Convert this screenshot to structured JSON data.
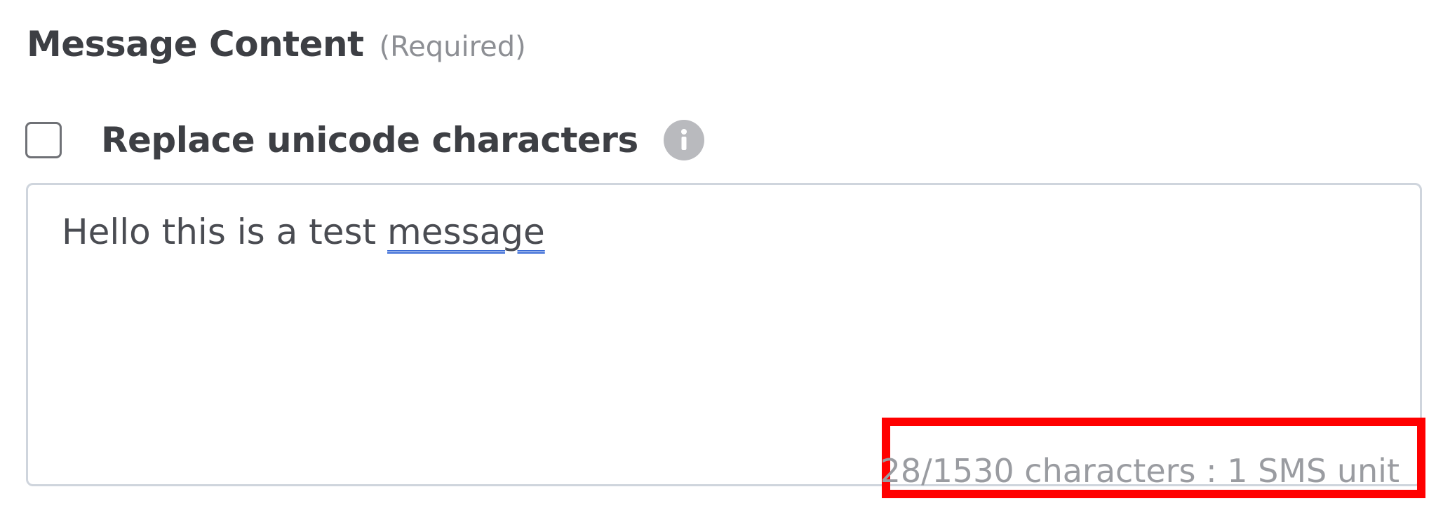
{
  "section": {
    "title": "Message Content",
    "required_label": "(Required)"
  },
  "options": {
    "replace_unicode": {
      "label": "Replace unicode characters",
      "checked": false,
      "info_icon": "info-icon"
    }
  },
  "message": {
    "text_before": "Hello this is a test ",
    "misspelled_word": "message"
  },
  "counter": {
    "text": "28/1530 characters : 1 SMS unit"
  },
  "colors": {
    "highlight": "#ff0000",
    "spellcheck_underline": "#3a6bd6",
    "info_icon_bg": "#b9babe"
  }
}
